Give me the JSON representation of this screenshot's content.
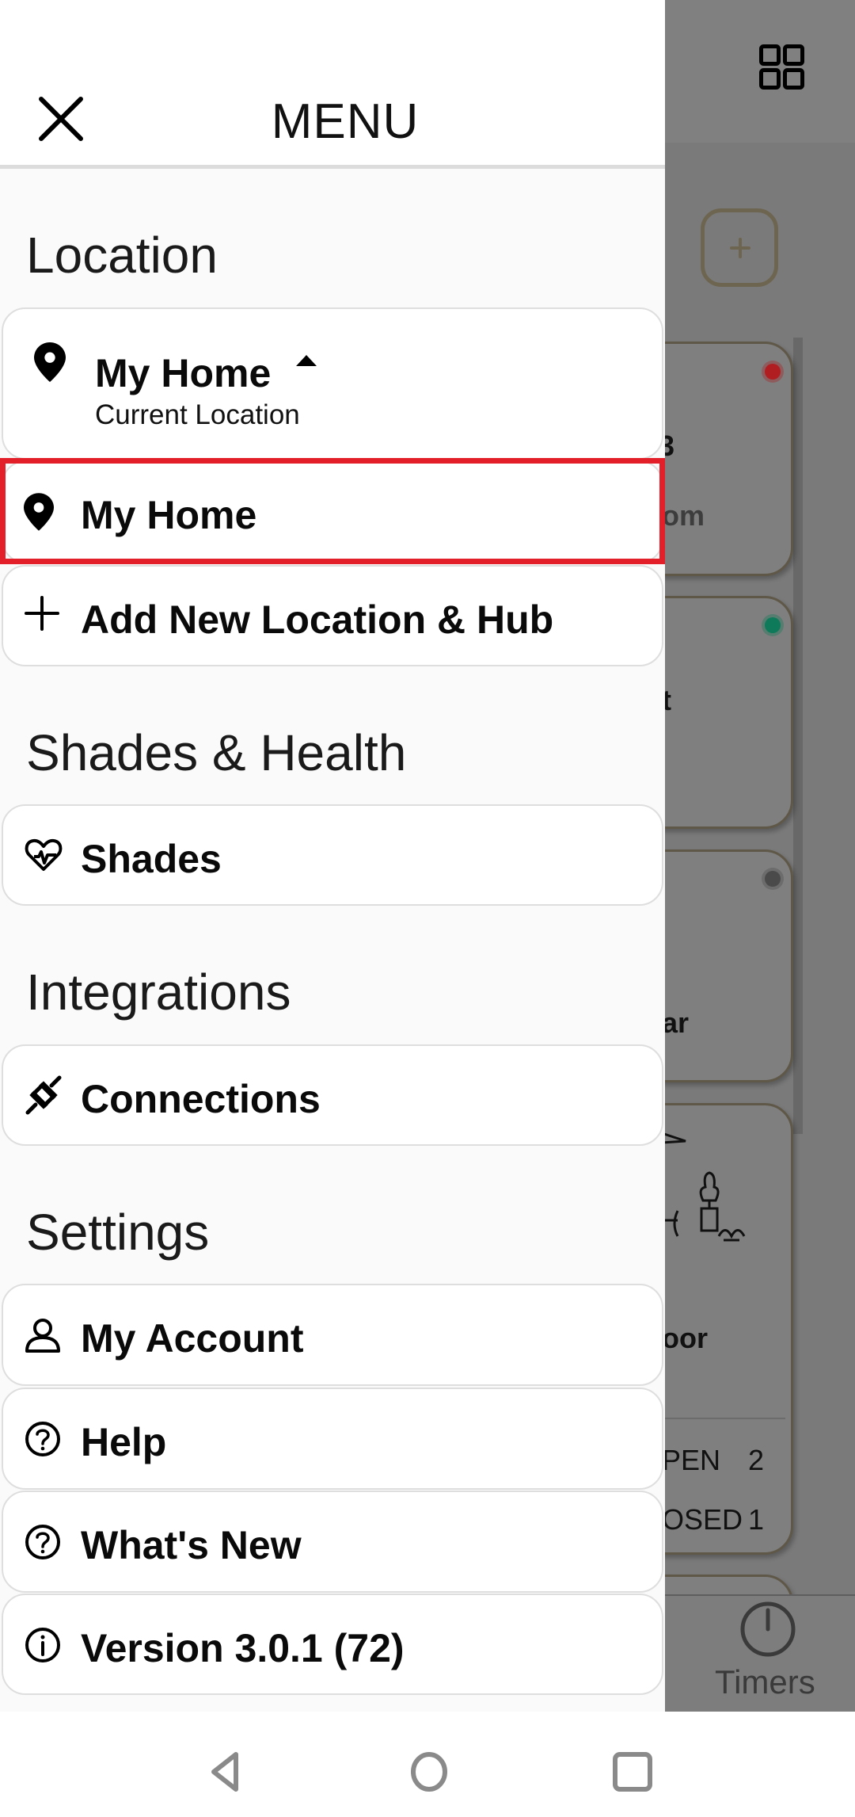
{
  "drawer": {
    "title": "MENU",
    "close_icon": "close-icon",
    "sections": {
      "location": {
        "heading": "Location",
        "current": {
          "name": "My Home",
          "subtitle": "Current Location",
          "icon": "map-pin-icon",
          "expand_icon": "caret-up-icon"
        },
        "locations": [
          {
            "name": "My Home",
            "icon": "map-pin-icon",
            "highlighted": true
          }
        ],
        "add": {
          "label": "Add New Location & Hub",
          "icon": "plus-icon"
        }
      },
      "shades_health": {
        "heading": "Shades & Health",
        "items": [
          {
            "label": "Shades",
            "icon": "heart-pulse-icon"
          }
        ]
      },
      "integrations": {
        "heading": "Integrations",
        "items": [
          {
            "label": "Connections",
            "icon": "plug-icon"
          }
        ]
      },
      "settings": {
        "heading": "Settings",
        "items": [
          {
            "label": "My Account",
            "icon": "user-icon"
          },
          {
            "label": "Help",
            "icon": "help-circle-icon"
          },
          {
            "label": "What's New",
            "icon": "help-circle-icon"
          },
          {
            "label": "Version 3.0.1 (72)",
            "icon": "info-circle-icon"
          }
        ]
      }
    }
  },
  "background": {
    "grid_icon": "grid-view-icon",
    "add_icon": "plus-icon",
    "cards": [
      {
        "partial_title": "3",
        "partial_subtitle": "om",
        "status_color": "#b01e22"
      },
      {
        "partial_title": "t",
        "status_color": "#0e7a5a"
      },
      {
        "partial_title": "ar",
        "status_color": "#4a4a4a"
      },
      {
        "partial_title": "oor",
        "rows": [
          {
            "label": "PEN",
            "count": "2"
          },
          {
            "label": "OSED",
            "count": "1"
          }
        ]
      }
    ],
    "bottom_nav": {
      "timers_label": "Timers",
      "timers_icon": "clock-icon"
    }
  },
  "highlight_color": "#e3202a",
  "system_nav": {
    "back": "back-icon",
    "home": "home-icon",
    "recents": "recents-icon"
  }
}
